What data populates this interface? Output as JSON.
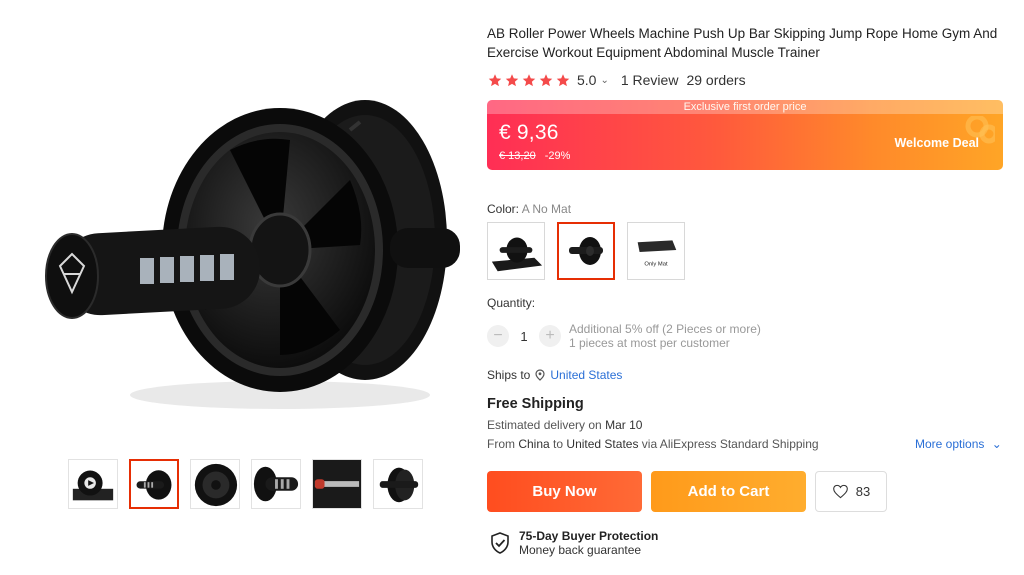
{
  "product": {
    "title": "AB Roller Power Wheels Machine Push Up Bar Skipping Jump Rope Home Gym And Exercise Workout Equipment Abdominal Muscle Trainer",
    "rating": "5.0",
    "rating_stars": 5,
    "reviews": "1 Review",
    "orders": "29 orders"
  },
  "price": {
    "strip": "Exclusive first order price",
    "current": "€ 9,36",
    "original": "€ 13,20",
    "discount": "-29%",
    "deal_label": "Welcome Deal"
  },
  "color": {
    "label": "Color:",
    "value": "A No Mat",
    "options": [
      {
        "name": "mat-with-wheel"
      },
      {
        "name": "a-no-mat",
        "selected": true
      },
      {
        "name": "only-mat",
        "text": "Only Mat"
      }
    ]
  },
  "quantity": {
    "label": "Quantity:",
    "value": "1",
    "minus": "−",
    "plus": "+",
    "note1": "Additional 5% off (2 Pieces or more)",
    "note2": "1 pieces at most per customer"
  },
  "shipping": {
    "ships_to_label": "Ships to",
    "country": "United States",
    "free": "Free Shipping",
    "est_prefix": "Estimated delivery on",
    "est_date": "Mar 10",
    "from_prefix": "From",
    "from_country": "China",
    "to_word": "to",
    "to_country": "United States",
    "via": "via AliExpress Standard Shipping",
    "more_options": "More options"
  },
  "actions": {
    "buy_now": "Buy Now",
    "add_to_cart": "Add to Cart",
    "wishlist_count": "83"
  },
  "protection": {
    "title": "75-Day Buyer Protection",
    "subtitle": "Money back guarantee"
  },
  "gallery": {
    "thumb_count": 6,
    "selected_index": 1
  },
  "colors": {
    "accent": "#e62e04",
    "link": "#2a6fd6",
    "star": "#f44a4a"
  }
}
